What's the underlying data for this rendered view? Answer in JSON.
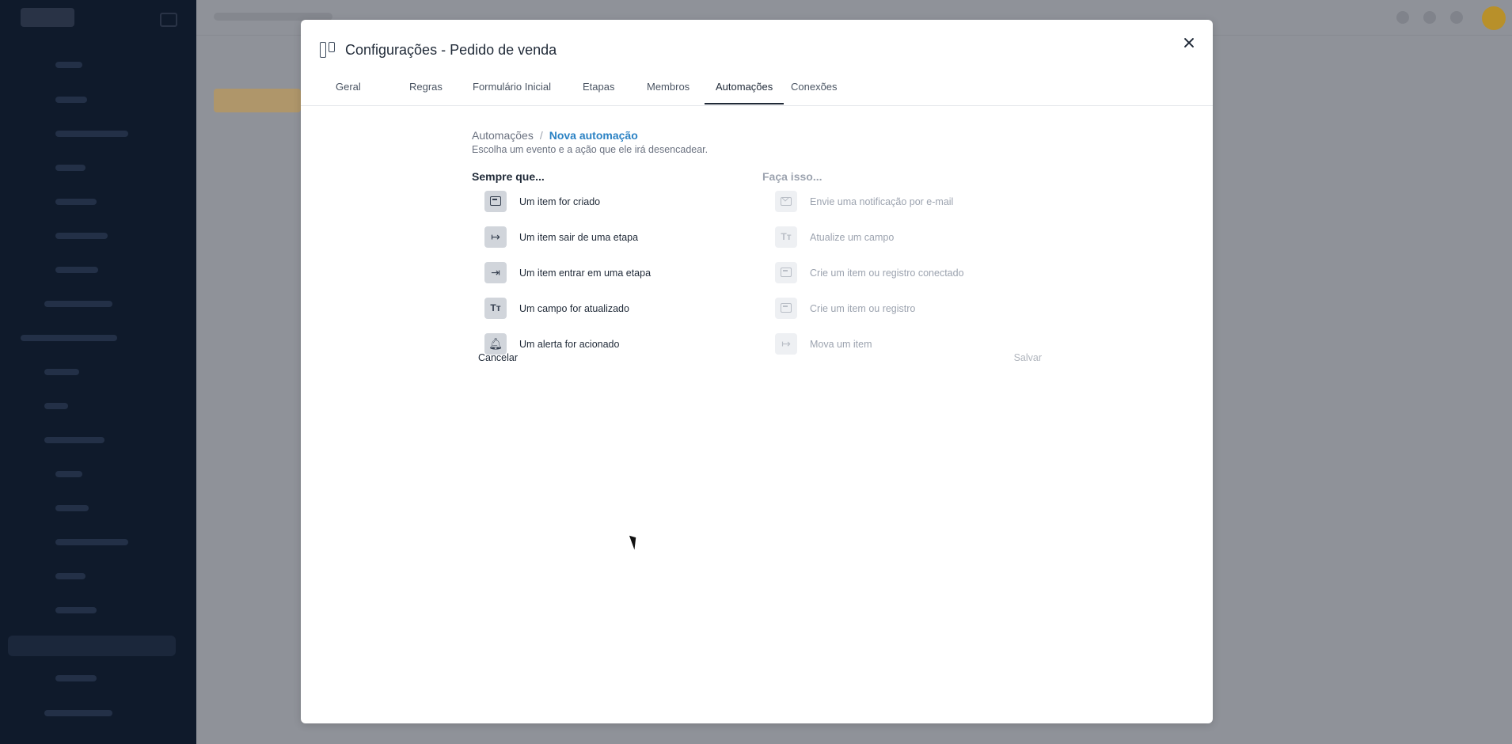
{
  "modal": {
    "title": "Configurações - Pedido de venda",
    "tabs": [
      {
        "label": "Geral"
      },
      {
        "label": "Regras"
      },
      {
        "label": "Formulário Inicial"
      },
      {
        "label": "Etapas"
      },
      {
        "label": "Membros"
      },
      {
        "label": "Automações",
        "active": true
      },
      {
        "label": "Conexões"
      }
    ],
    "breadcrumb": {
      "root": "Automações",
      "separator": "/",
      "current": "Nova automação"
    },
    "subtitle": "Escolha um evento e a ação que ele irá desencadear.",
    "triggers": {
      "title": "Sempre que...",
      "items": [
        {
          "label": "Um item for criado",
          "icon": "card-icon"
        },
        {
          "label": "Um item sair de uma etapa",
          "icon": "exit-icon"
        },
        {
          "label": "Um item entrar em uma etapa",
          "icon": "enter-icon"
        },
        {
          "label": "Um campo for atualizado",
          "icon": "text-field-icon"
        },
        {
          "label": "Um alerta for acionado",
          "icon": "bell-icon"
        }
      ]
    },
    "actions": {
      "title": "Faça isso...",
      "items": [
        {
          "label": "Envie uma notificação por e-mail",
          "icon": "mail-icon"
        },
        {
          "label": "Atualize um campo",
          "icon": "text-field-icon"
        },
        {
          "label": "Crie um item ou registro conectado",
          "icon": "card-icon"
        },
        {
          "label": "Crie um item ou registro",
          "icon": "card-icon"
        },
        {
          "label": "Mova um item",
          "icon": "move-icon"
        }
      ]
    },
    "footer": {
      "cancel_label": "Cancelar",
      "save_label": "Salvar"
    }
  },
  "colors": {
    "accent": "#2b82c4",
    "overlay": "#8e9199",
    "sidebar": "#0f1a2b"
  }
}
